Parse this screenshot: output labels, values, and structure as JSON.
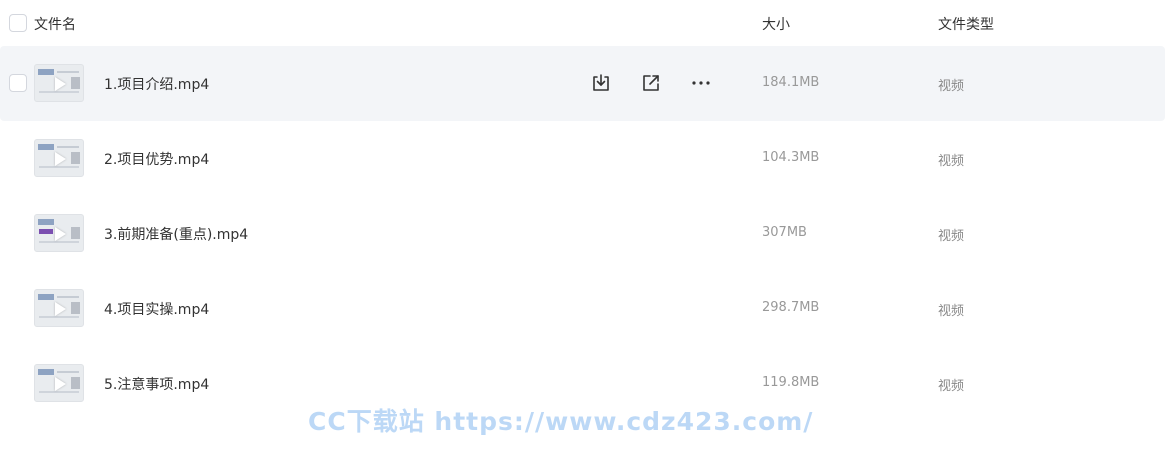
{
  "header": {
    "name_label": "文件名",
    "size_label": "大小",
    "type_label": "文件类型"
  },
  "files": [
    {
      "name": "1.项目介绍.mp4",
      "size": "184.1MB",
      "type": "视频"
    },
    {
      "name": "2.项目优势.mp4",
      "size": "104.3MB",
      "type": "视频"
    },
    {
      "name": "3.前期准备(重点).mp4",
      "size": "307MB",
      "type": "视频"
    },
    {
      "name": "4.项目实操.mp4",
      "size": "298.7MB",
      "type": "视频"
    },
    {
      "name": "5.注意事项.mp4",
      "size": "119.8MB",
      "type": "视频"
    }
  ],
  "row_actions": {
    "download_icon": "download-icon",
    "share_icon": "share-icon",
    "more_icon": "more-icon"
  },
  "watermark": "CC下载站 https://www.cdz423.com/",
  "colors": {
    "hover_row": "#f3f5f8",
    "icon": "#333333",
    "watermark": "#bcd8f6"
  }
}
